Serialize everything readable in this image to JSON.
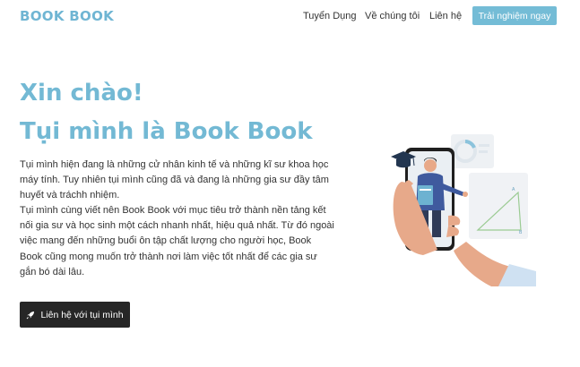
{
  "header": {
    "logo": "BOOK BOOK",
    "nav": [
      "Tuyển Dụng",
      "Về chúng tôi",
      "Liên hệ"
    ],
    "cta": "Trải nghiệm ngay"
  },
  "hero": {
    "greeting": "Xin chào!",
    "title": "Tụi mình là Book Book",
    "paragraph_1": "Tụi mình hiện đang là những cử nhân kinh tế và những kĩ sư khoa học máy tính. Tuy nhiên tụi mình cũng đã và đang là những gia sư đầy tâm huyết và tráchh nhiệm.",
    "paragraph_2": "Tụi mình cùng viết nên Book Book với mục tiêu trở thành nền tảng kết nối gia sư và học sinh một cách nhanh nhất, hiệu quả nhất. Từ đó ngoài việc mang đến những buổi ôn tập chất lượng cho người học, Book Book cũng mong muốn trở thành nơi làm việc tốt nhất để các gia sư gắn bó dài lâu.",
    "contact_button": "Liên hệ với tụi mình",
    "contact_icon": "rocket-icon"
  },
  "illustration": {
    "description_icon": "tutor-on-phone-illustration",
    "chart_label_a": "A",
    "chart_label_b": "B"
  },
  "colors": {
    "brand": "#73b9d4",
    "dark_button": "#262626"
  }
}
